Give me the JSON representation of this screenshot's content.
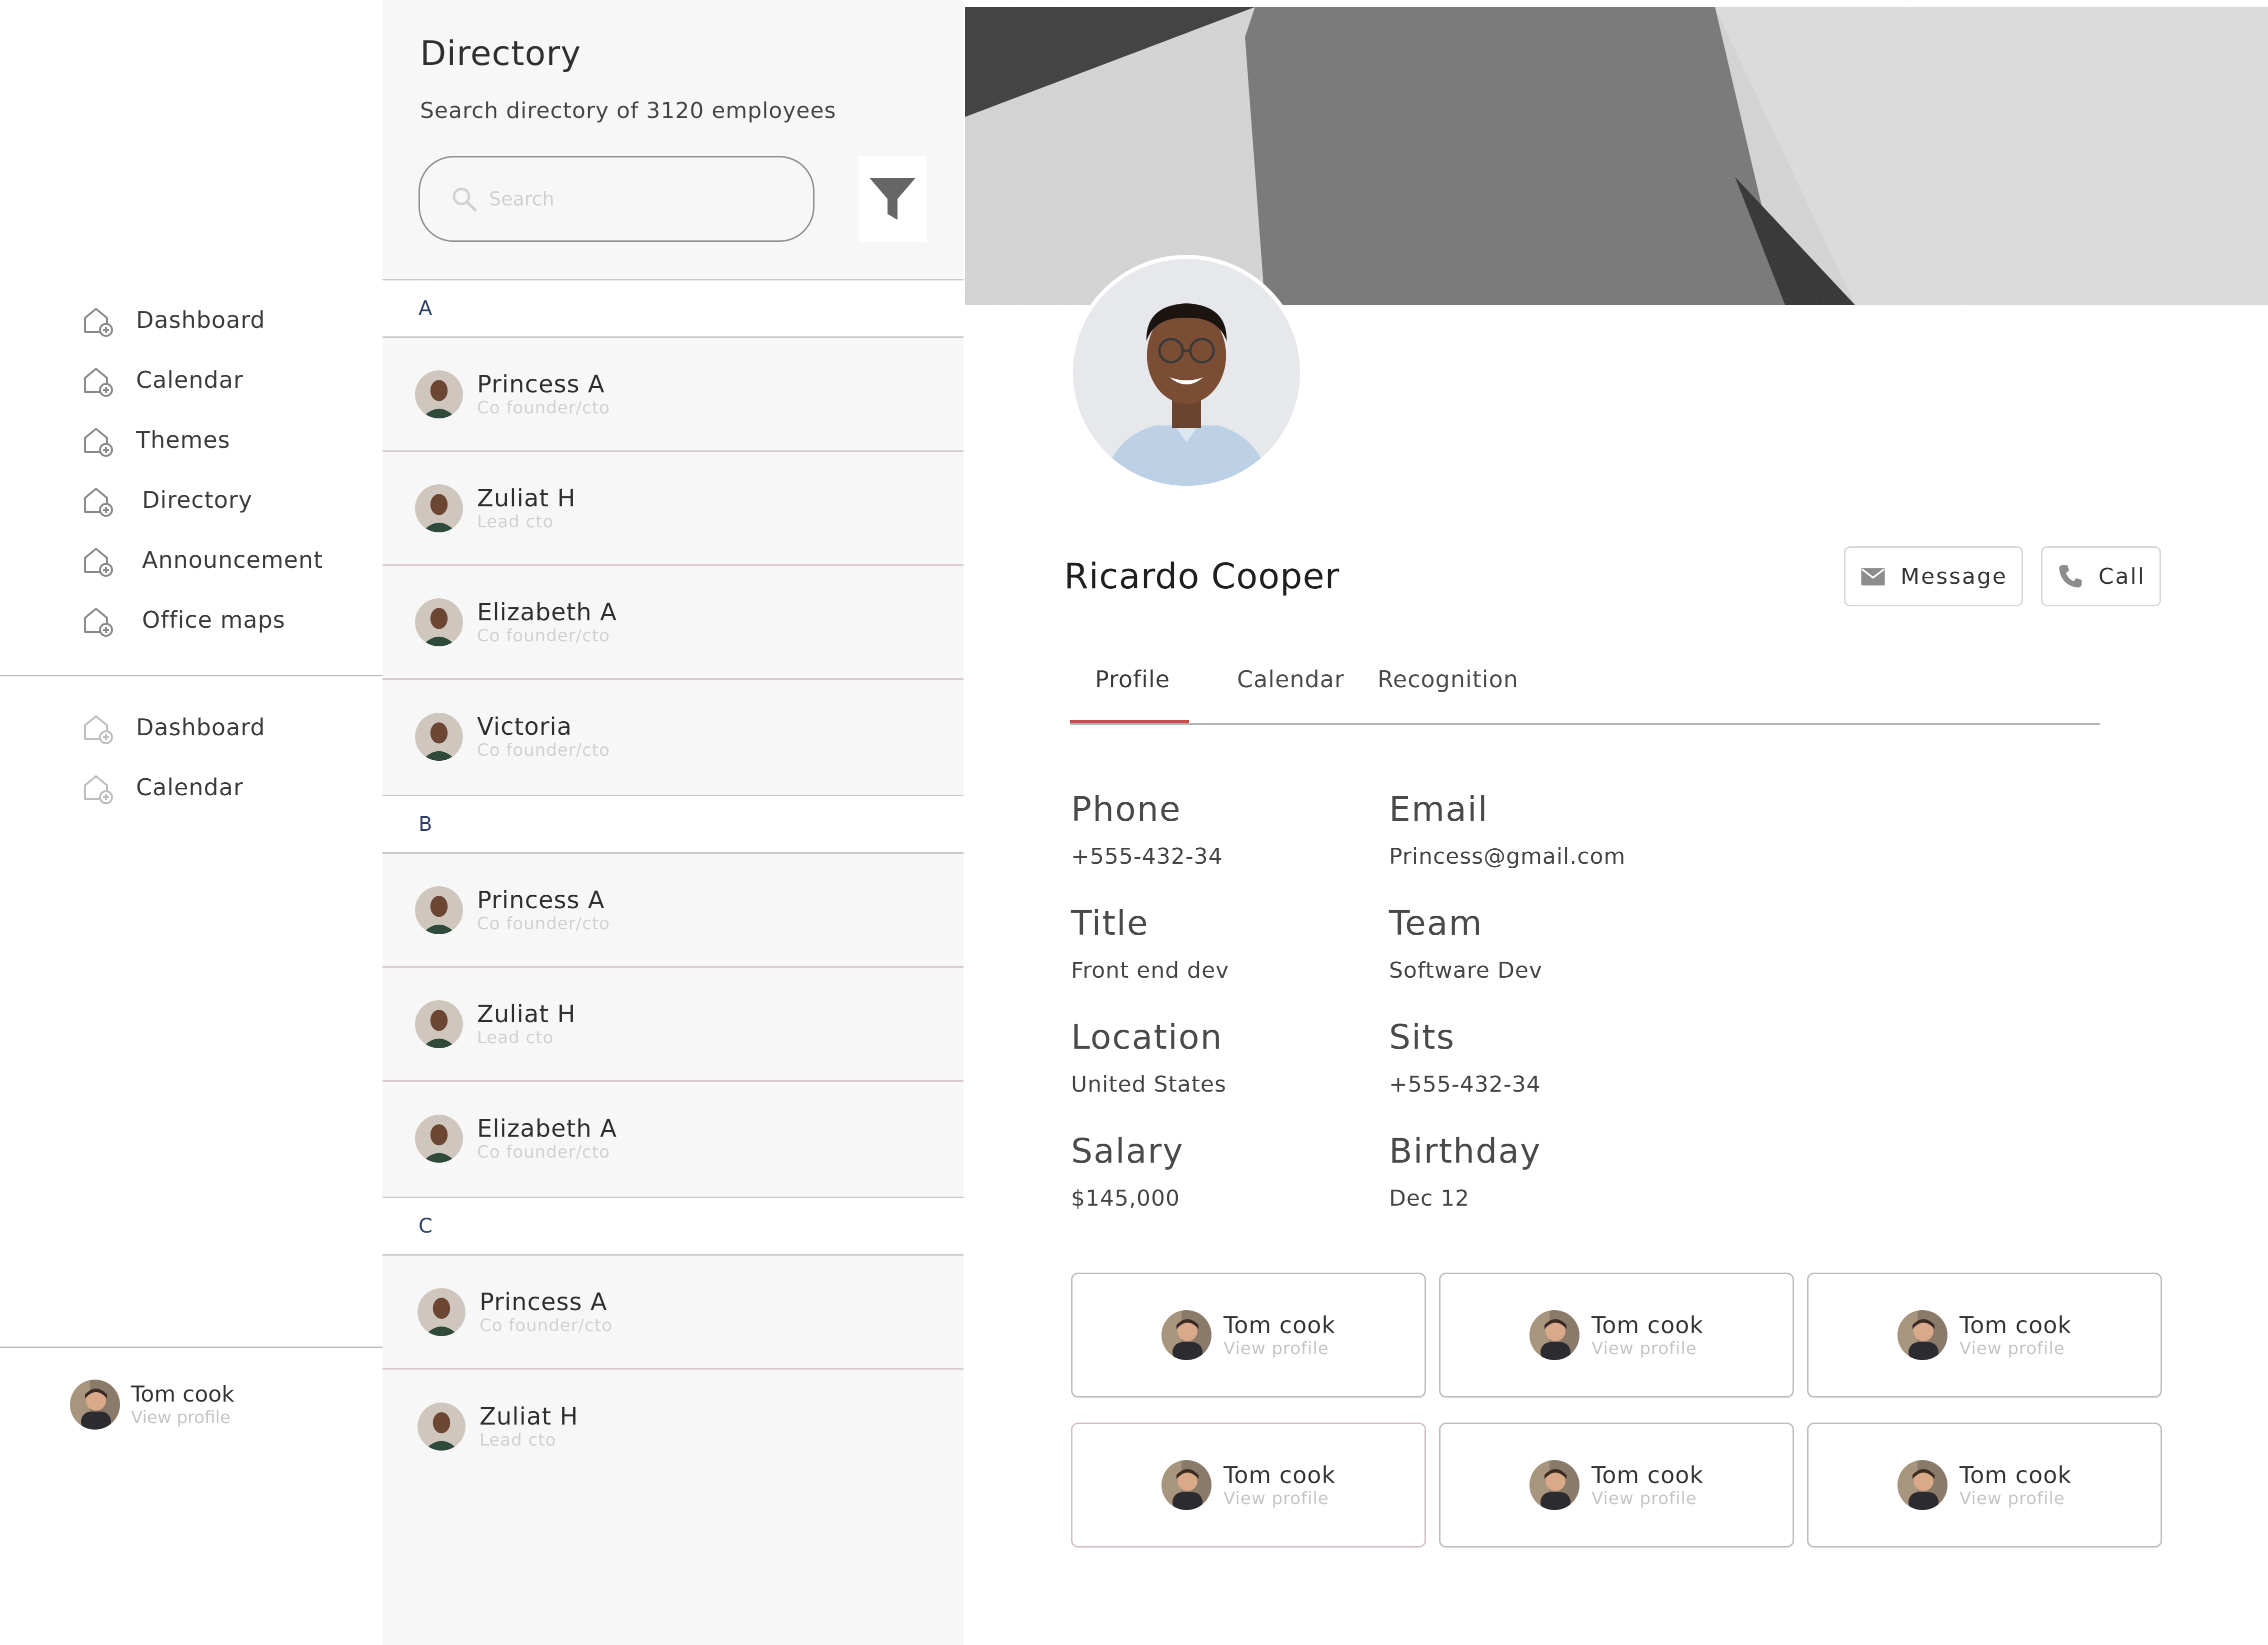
{
  "sidebar": {
    "nav_primary": [
      {
        "label": "Dashboard",
        "icon": "home-plus-icon"
      },
      {
        "label": "Calendar",
        "icon": "home-plus-icon"
      },
      {
        "label": "Themes",
        "icon": "home-plus-icon"
      },
      {
        "label": "Directory",
        "icon": "home-plus-icon"
      },
      {
        "label": "Announcement",
        "icon": "home-plus-icon"
      },
      {
        "label": "Office maps",
        "icon": "home-plus-icon"
      }
    ],
    "nav_secondary": [
      {
        "label": "Dashboard",
        "icon": "home-plus-icon"
      },
      {
        "label": "Calendar",
        "icon": "home-plus-icon"
      }
    ],
    "user": {
      "name": "Tom cook",
      "subtitle": "View profile"
    }
  },
  "directory": {
    "title": "Directory",
    "subtitle": "Search directory of  3120 employees",
    "search_placeholder": "Search",
    "sections": [
      {
        "letter": "A",
        "people": [
          {
            "name": "Princess A",
            "role": "Co founder/cto"
          },
          {
            "name": "Zuliat H",
            "role": "Lead cto"
          },
          {
            "name": "Elizabeth A",
            "role": "Co founder/cto"
          },
          {
            "name": "Victoria",
            "role": "Co founder/cto"
          }
        ]
      },
      {
        "letter": "B",
        "people": [
          {
            "name": "Princess A",
            "role": "Co founder/cto"
          },
          {
            "name": "Zuliat H",
            "role": "Lead cto"
          },
          {
            "name": "Elizabeth A",
            "role": "Co founder/cto"
          }
        ]
      },
      {
        "letter": "C",
        "people": [
          {
            "name": "Princess A",
            "role": "Co founder/cto"
          },
          {
            "name": "Zuliat H",
            "role": "Lead cto"
          }
        ]
      }
    ]
  },
  "profile": {
    "name": "Ricardo Cooper",
    "actions": {
      "message": "Message",
      "call": "Call"
    },
    "tabs": [
      "Profile",
      "Calendar",
      "Recognition"
    ],
    "active_tab": "Profile",
    "fields": {
      "phone": {
        "label": "Phone",
        "value": "+555-432-34"
      },
      "email": {
        "label": "Email",
        "value": "Princess@gmail.com"
      },
      "title": {
        "label": "Title",
        "value": "Front end dev"
      },
      "team": {
        "label": "Team",
        "value": "Software Dev"
      },
      "location": {
        "label": "Location",
        "value": "United States"
      },
      "sits": {
        "label": "Sits",
        "value": "+555-432-34"
      },
      "salary": {
        "label": "Salary",
        "value": "$145,000"
      },
      "birthday": {
        "label": "Birthday",
        "value": "Dec 12"
      }
    },
    "team_cards": [
      {
        "name": "Tom cook",
        "subtitle": "View profile"
      },
      {
        "name": "Tom cook",
        "subtitle": "View profile"
      },
      {
        "name": "Tom cook",
        "subtitle": "View profile"
      },
      {
        "name": "Tom cook",
        "subtitle": "View profile"
      },
      {
        "name": "Tom cook",
        "subtitle": "View profile"
      },
      {
        "name": "Tom cook",
        "subtitle": "View profile"
      }
    ]
  },
  "colors": {
    "accent": "#c94b4b",
    "sidebar_text": "#3a3a3a",
    "muted": "#c3c3c3",
    "directory_bg": "#f7f7f7"
  }
}
